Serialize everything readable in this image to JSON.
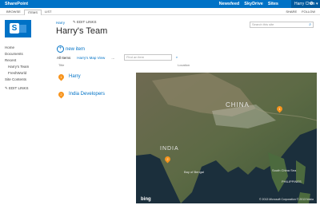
{
  "suite": {
    "brand": "SharePoint",
    "links": [
      "Newsfeed",
      "SkyDrive",
      "Sites"
    ],
    "user": "Harry Chen ▾"
  },
  "ribbon": {
    "tabs": [
      "BROWSE",
      "ITEMS",
      "LIST"
    ],
    "actions": [
      "SHARE",
      "FOLLOW"
    ]
  },
  "header": {
    "breadcrumb": "Harry",
    "edit_links": "EDIT LINKS",
    "title": "Harry's Team",
    "search_placeholder": "Search this site"
  },
  "nav": {
    "items": [
      "Home",
      "Documents",
      "Recent",
      "Harry's Team",
      "FreshWorld",
      "Site Contents"
    ],
    "edit_links": "EDIT LINKS"
  },
  "list": {
    "new_item": "new item",
    "views": [
      "All Items",
      "Harry's Map View",
      "..."
    ],
    "find_placeholder": "Find an item",
    "col_title": "Title",
    "col_location": "Location",
    "rows": [
      {
        "pin": "1",
        "title": "Harry"
      },
      {
        "pin": "2",
        "title": "India Developers"
      }
    ]
  },
  "map": {
    "labels": [
      "CHINA",
      "INDIA",
      "Bay of Bengal",
      "South China Sea",
      "PHILIPPINES"
    ],
    "attribution": "© 2013 Microsoft Corporation  © 2013 Nokia",
    "logo": "bing"
  },
  "colors": {
    "suite_blue": "#0072c6",
    "pin_orange": "#f7941d"
  }
}
